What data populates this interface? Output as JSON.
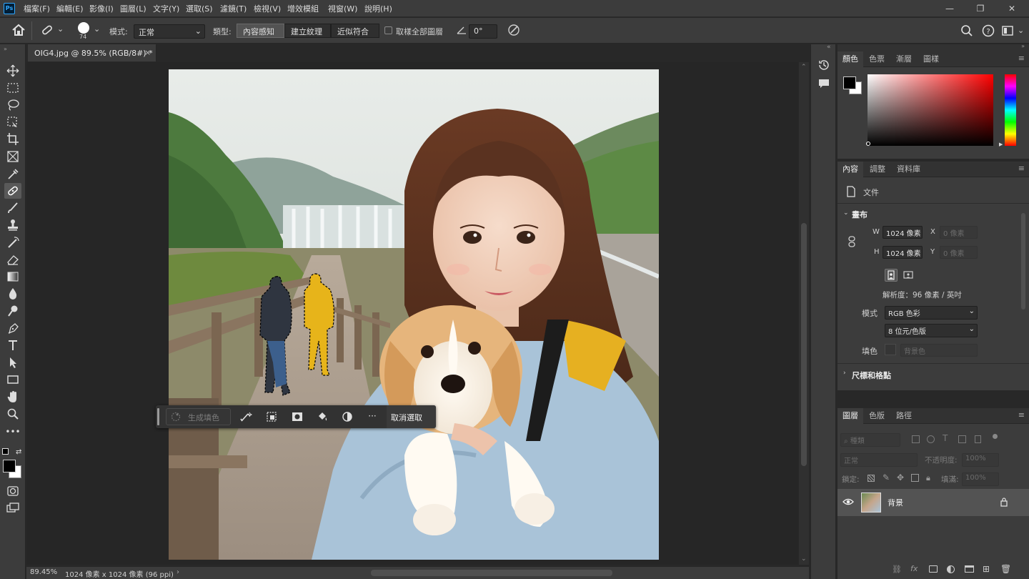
{
  "app": {
    "logo": "Ps"
  },
  "menu": [
    "檔案(F)",
    "編輯(E)",
    "影像(I)",
    "圖層(L)",
    "文字(Y)",
    "選取(S)",
    "濾鏡(T)",
    "檢視(V)",
    "增效模組",
    "視窗(W)",
    "說明(H)"
  ],
  "window_controls": {
    "minimize": "—",
    "restore": "❐",
    "close": "✕"
  },
  "options": {
    "brush_size": "74",
    "mode_label": "模式:",
    "mode_value": "正常",
    "type_label": "類型:",
    "types": [
      "內容感知",
      "建立紋理",
      "近似符合"
    ],
    "active_type": "內容感知",
    "sample_all_label": "取樣全部圖層",
    "angle_value": "0°"
  },
  "document": {
    "tab_title": "OIG4.jpg @ 89.5% (RGB/8#) *",
    "close_glyph": "×"
  },
  "status": {
    "zoom": "89.45%",
    "info": "1024 像素 x 1024 像素 (96 ppi)",
    "arrow": "›"
  },
  "context_bar": {
    "generative_fill": "生成填色",
    "deselect": "取消選取",
    "more": "···"
  },
  "panels": {
    "color_tabs": [
      "顏色",
      "色票",
      "漸層",
      "圖樣"
    ],
    "properties_tabs": [
      "內容",
      "調整",
      "資料庫"
    ],
    "doc_label": "文件",
    "canvas_section": "畫布",
    "width_label": "W",
    "width_value": "1024 像素",
    "height_label": "H",
    "height_value": "1024 像素",
    "x_label": "X",
    "x_placeholder": "0 像素",
    "y_label": "Y",
    "y_placeholder": "0 像素",
    "resolution": "解析度：96 像素 / 英吋",
    "mode_label": "模式",
    "mode_value": "RGB 色彩",
    "bit_depth": "8 位元/色版",
    "fill_label": "填色",
    "fill_value": "背景色",
    "rulers_section": "尺標和格點",
    "layers_tabs": [
      "圖層",
      "色版",
      "路徑"
    ],
    "layer_filter": "種類",
    "blend_mode": "正常",
    "opacity_label": "不透明度:",
    "opacity_value": "100%",
    "lock_label": "鎖定:",
    "fill_opacity_label": "填滿:",
    "fill_opacity_value": "100%",
    "layer_name": "背景"
  },
  "colors": {
    "accent": "#31a8ff",
    "ui_bg": "#3c3c3c",
    "canvas_bg": "#262626",
    "foreground": "#000000",
    "background": "#ffffff"
  }
}
